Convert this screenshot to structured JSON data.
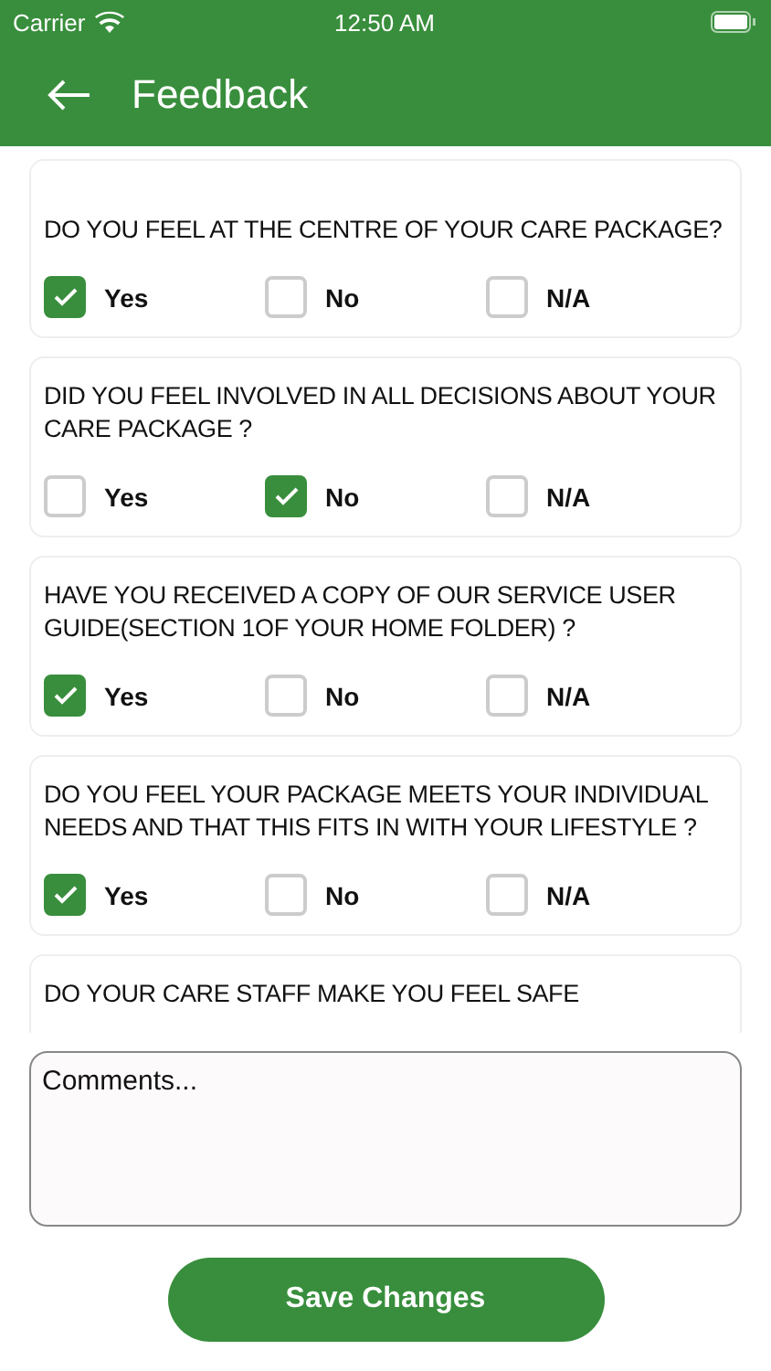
{
  "status_bar": {
    "carrier": "Carrier",
    "time": "12:50 AM"
  },
  "header": {
    "title": "Feedback"
  },
  "questions": [
    {
      "text": "DO YOU FEEL AT THE CENTRE OF YOUR CARE PACKAGE?",
      "options": [
        {
          "label": "Yes",
          "checked": true
        },
        {
          "label": "No",
          "checked": false
        },
        {
          "label": "N/A",
          "checked": false
        }
      ]
    },
    {
      "text": "DID YOU FEEL INVOLVED IN ALL DECISIONS ABOUT YOUR CARE PACKAGE ?",
      "options": [
        {
          "label": "Yes",
          "checked": false
        },
        {
          "label": "No",
          "checked": true
        },
        {
          "label": "N/A",
          "checked": false
        }
      ]
    },
    {
      "text": "HAVE YOU RECEIVED A COPY OF OUR SERVICE USER GUIDE(SECTION 1OF YOUR HOME FOLDER) ?",
      "options": [
        {
          "label": "Yes",
          "checked": true
        },
        {
          "label": "No",
          "checked": false
        },
        {
          "label": "N/A",
          "checked": false
        }
      ]
    },
    {
      "text": "DO YOU FEEL YOUR PACKAGE MEETS YOUR INDIVIDUAL NEEDS AND THAT THIS FITS IN WITH YOUR LIFESTYLE ?",
      "options": [
        {
          "label": "Yes",
          "checked": true
        },
        {
          "label": "No",
          "checked": false
        },
        {
          "label": "N/A",
          "checked": false
        }
      ]
    },
    {
      "text": "DO YOUR CARE STAFF MAKE YOU FEEL SAFE"
    }
  ],
  "comments": {
    "placeholder": "Comments..."
  },
  "save_button": {
    "label": "Save Changes"
  }
}
